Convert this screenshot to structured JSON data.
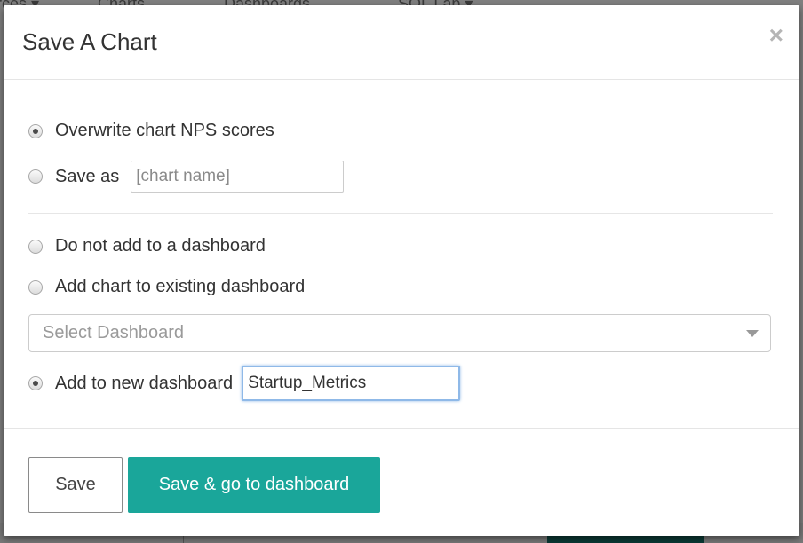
{
  "background_nav": {
    "sources": "rces ▾",
    "charts": "Charts",
    "dashboards": "Dashboards",
    "sqllab": "SQL Lab ▾"
  },
  "modal": {
    "title": "Save A Chart",
    "close_glyph": "×",
    "overwrite_label": "Overwrite chart NPS scores",
    "overwrite_checked": true,
    "saveas_label": "Save as",
    "saveas_placeholder": "[chart name]",
    "no_dashboard_label": "Do not add to a dashboard",
    "existing_dashboard_label": "Add chart to existing dashboard",
    "select_dashboard_placeholder": "Select Dashboard",
    "new_dashboard_label": "Add to new dashboard",
    "new_dashboard_value": "Startup_Metrics",
    "new_dashboard_checked": true,
    "save_button": "Save",
    "save_go_button": "Save & go to dashboard"
  },
  "colors": {
    "primary_button": "#1aa69a",
    "focus_ring": "#8fb9e8"
  }
}
